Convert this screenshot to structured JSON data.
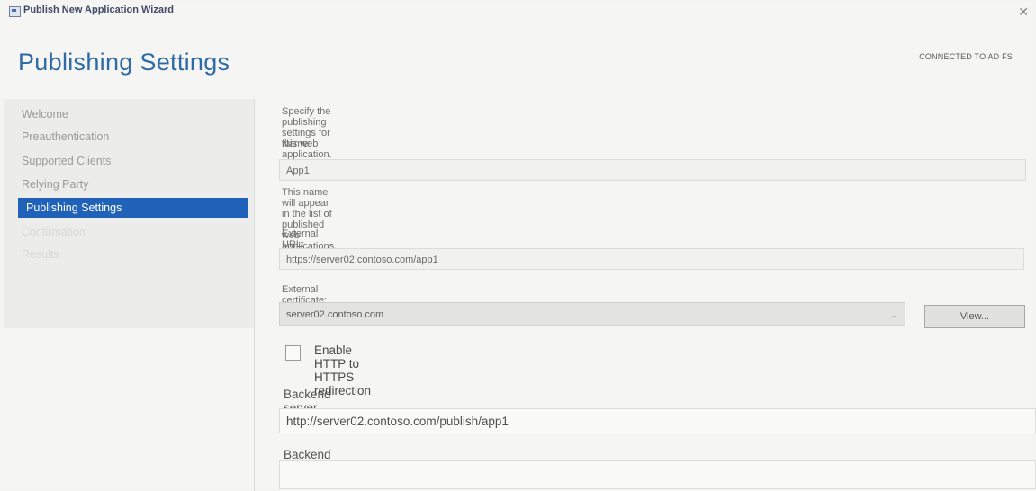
{
  "window": {
    "title": "Publish New Application Wizard",
    "close_glyph": "✕"
  },
  "header": {
    "title": "Publishing Settings",
    "connection_status": "CONNECTED TO AD FS"
  },
  "sidebar": {
    "items": [
      {
        "label": "Welcome"
      },
      {
        "label": "Preauthentication"
      },
      {
        "label": "Supported Clients"
      },
      {
        "label": "Relying Party"
      },
      {
        "label": "Publishing Settings"
      },
      {
        "label": "Confirmation"
      },
      {
        "label": "Results"
      }
    ]
  },
  "form": {
    "instructions": "Specify the publishing settings for this web application.",
    "name_label": "Name:",
    "name_value": "App1",
    "name_hint": "This name will appear in the list of published web applications.",
    "external_url_label": "External URL:",
    "external_url_value": "https://server02.contoso.com/app1",
    "certificate_label": "External certificate:",
    "certificate_value": "server02.contoso.com",
    "view_button": "View...",
    "redirect_checkbox_label": "Enable HTTP to HTTPS redirection",
    "redirect_checked": false,
    "backend_url_label": "Backend server URL:",
    "backend_url_value": "http://server02.contoso.com/publish/app1",
    "backend_spn_label": "Backend server SPN:",
    "backend_spn_value": ""
  }
}
